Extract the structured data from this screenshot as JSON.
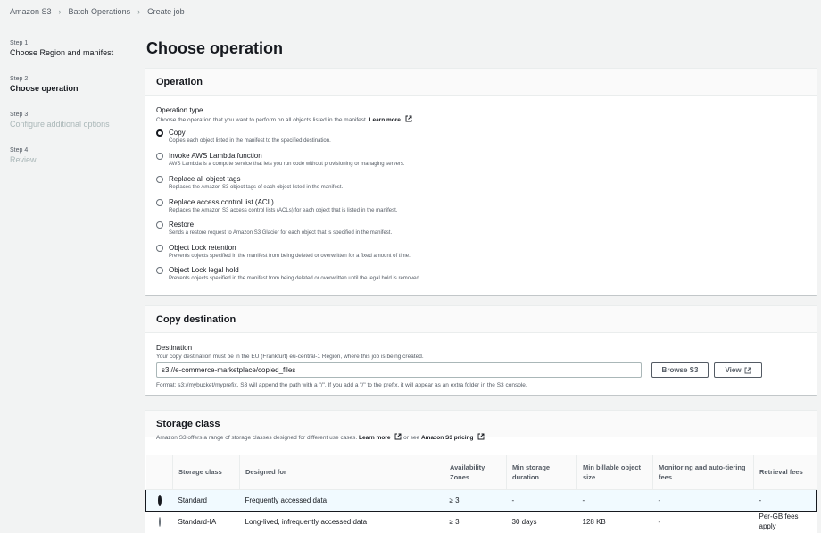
{
  "breadcrumb": {
    "items": [
      "Amazon S3",
      "Batch Operations",
      "Create job"
    ]
  },
  "steps": [
    {
      "num": "Step 1",
      "name": "Choose Region and manifest",
      "state": "done"
    },
    {
      "num": "Step 2",
      "name": "Choose operation",
      "state": "active"
    },
    {
      "num": "Step 3",
      "name": "Configure additional options",
      "state": "disabled"
    },
    {
      "num": "Step 4",
      "name": "Review",
      "state": "disabled"
    }
  ],
  "page_title": "Choose operation",
  "operation": {
    "header": "Operation",
    "label": "Operation type",
    "description": "Choose the operation that you want to perform on all objects listed in the manifest.",
    "learn_more": "Learn more",
    "options": [
      {
        "label": "Copy",
        "desc": "Copies each object listed in the manifest to the specified destination.",
        "checked": true
      },
      {
        "label": "Invoke AWS Lambda function",
        "desc": "AWS Lambda is a compute service that lets you run code without provisioning or managing servers.",
        "checked": false
      },
      {
        "label": "Replace all object tags",
        "desc": "Replaces the Amazon S3 object tags of each object listed in the manifest.",
        "checked": false
      },
      {
        "label": "Replace access control list (ACL)",
        "desc": "Replaces the Amazon S3 access control lists (ACLs) for each object that is listed in the manifest.",
        "checked": false
      },
      {
        "label": "Restore",
        "desc": "Sends a restore request to Amazon S3 Glacier for each object that is specified in the manifest.",
        "checked": false
      },
      {
        "label": "Object Lock retention",
        "desc": "Prevents objects specified in the manifest from being deleted or overwritten for a fixed amount of time.",
        "checked": false
      },
      {
        "label": "Object Lock legal hold",
        "desc": "Prevents objects specified in the manifest from being deleted or overwritten until the legal hold is removed.",
        "checked": false
      }
    ]
  },
  "copy_destination": {
    "header": "Copy destination",
    "label": "Destination",
    "description": "Your copy destination must be in the EU (Frankfurt) eu-central-1 Region, where this job is being created.",
    "value": "s3://e-commerce-marketplace/copied_files",
    "browse_label": "Browse S3",
    "view_label": "View",
    "hint": "Format: s3://mybucket/myprefix. S3 will append the path with a \"/\". If you add a \"/\" to the prefix, it will appear as an extra folder in the S3 console."
  },
  "storage_class": {
    "header": "Storage class",
    "description": "Amazon S3 offers a range of storage classes designed for different use cases.",
    "learn_more": "Learn more",
    "or_see": "or see",
    "pricing_link": "Amazon S3 pricing",
    "columns": [
      "Storage class",
      "Designed for",
      "Availability Zones",
      "Min storage duration",
      "Min billable object size",
      "Monitoring and auto-tiering fees",
      "Retrieval fees"
    ],
    "rows": [
      {
        "selected": true,
        "cells": [
          "Standard",
          "Frequently accessed data",
          "≥ 3",
          "-",
          "-",
          "-",
          "-"
        ]
      },
      {
        "selected": false,
        "cells": [
          "Standard-IA",
          "Long-lived, infrequently accessed data",
          "≥ 3",
          "30 days",
          "128 KB",
          "-",
          "Per-GB fees apply"
        ]
      }
    ]
  },
  "icons": {
    "breadcrumb_separator": "chevron-right-icon",
    "external_link": "external-link-icon",
    "radio": "radio-button"
  },
  "colors": {
    "background": "#f2f3f3",
    "text": "#16191f",
    "muted": "#545b64",
    "selected_row_bg": "#f1faff"
  }
}
